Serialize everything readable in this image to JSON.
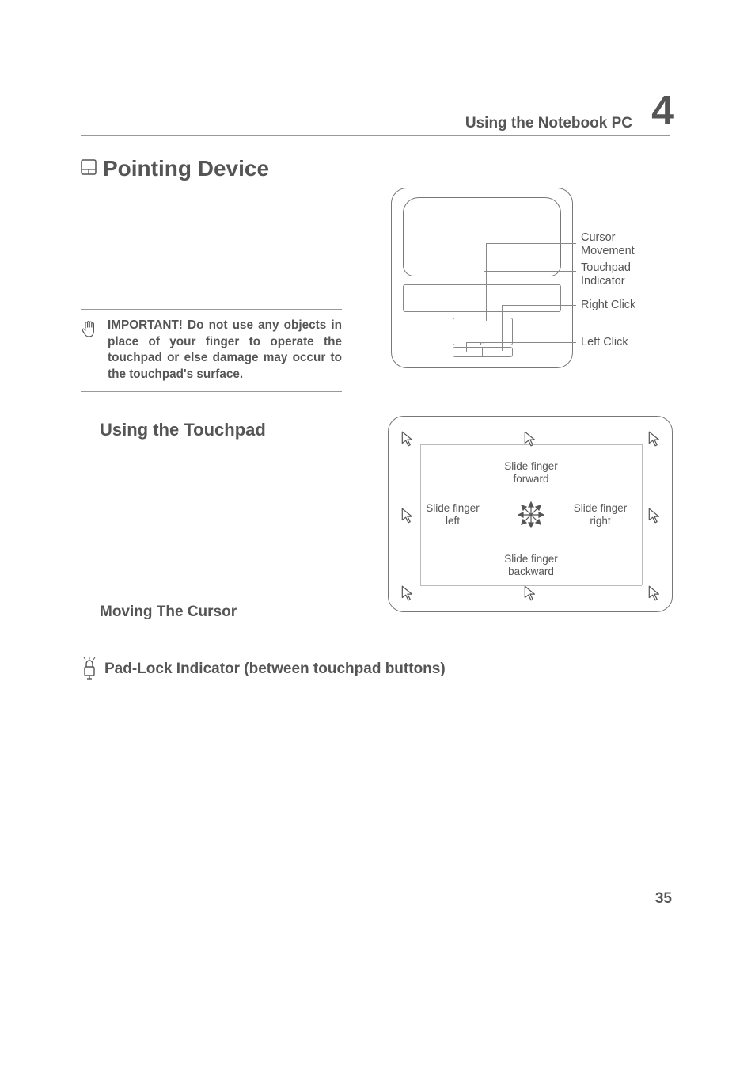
{
  "header": {
    "title": "Using the Notebook PC",
    "chapter_number": "4"
  },
  "sections": {
    "pointing_device": "Pointing Device",
    "using_touchpad": "Using the Touchpad",
    "moving_cursor": "Moving The Cursor",
    "padlock": "Pad-Lock Indicator (between touchpad buttons)"
  },
  "important_note": "IMPORTANT! Do not use any objects in place of your finger to operate the touchpad or else damage may occur to the touchpad's surface.",
  "laptop_diagram": {
    "label_cursor": "Cursor Movement",
    "label_indicator": "Touchpad Indicator",
    "label_right": "Right Click",
    "label_left": "Left Click"
  },
  "directions_diagram": {
    "forward": "Slide finger forward",
    "left": "Slide finger left",
    "right": "Slide finger right",
    "backward": "Slide finger backward"
  },
  "page_number": "35"
}
